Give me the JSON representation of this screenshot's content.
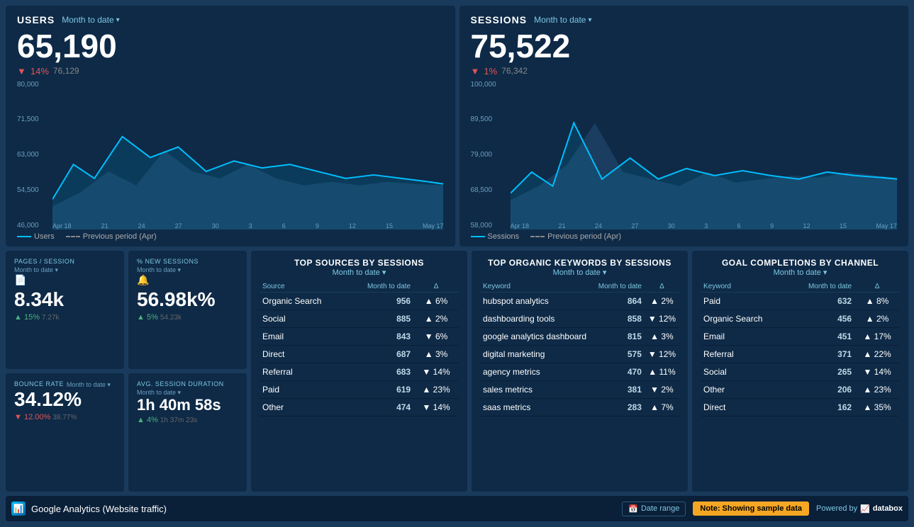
{
  "users": {
    "title": "USERS",
    "period": "Month to date",
    "value": "65,190",
    "change_pct": "14%",
    "change_dir": "down",
    "prev_value": "76,129",
    "legend_current": "Users",
    "legend_prev": "Previous period (Apr)",
    "y_labels": [
      "80,000",
      "71,500",
      "63,000",
      "54,500",
      "46,000"
    ],
    "x_labels": [
      "Apr 18",
      "21",
      "24",
      "27",
      "30",
      "3",
      "6",
      "9",
      "12",
      "15",
      "May 17"
    ]
  },
  "sessions": {
    "title": "SESSIONS",
    "period": "Month to date",
    "value": "75,522",
    "change_pct": "1%",
    "change_dir": "down",
    "prev_value": "76,342",
    "legend_current": "Sessions",
    "legend_prev": "Previous period (Apr)",
    "y_labels": [
      "100,000",
      "89,500",
      "79,000",
      "68,500",
      "58,000"
    ],
    "x_labels": [
      "Apr 18",
      "21",
      "24",
      "27",
      "30",
      "3",
      "6",
      "9",
      "12",
      "15",
      "May 17"
    ]
  },
  "metrics": {
    "pages_per_session": {
      "label": "PAGES / SESSION",
      "period": "Month to date",
      "value": "8.34k",
      "change_pct": "15%",
      "change_dir": "up",
      "prev_value": "7.27k"
    },
    "new_sessions": {
      "label": "% NEW SESSIONS",
      "period": "Month to date",
      "value": "56.98k%",
      "change_pct": "5%",
      "change_dir": "up",
      "prev_value": "54.23k"
    },
    "bounce_rate": {
      "label": "BOUNCE RATE",
      "period": "Month to date",
      "value": "34.12%",
      "change_pct": "12.00%",
      "change_dir": "down",
      "prev_value": "38.77%"
    },
    "avg_session": {
      "label": "AVG. SESSION DURATION",
      "period": "Month to date",
      "value": "1h 40m 58s",
      "change_pct": "4%",
      "change_dir": "up",
      "prev_value": "1h 37m 23s"
    }
  },
  "top_sources": {
    "title": "TOP SOURCES BY SESSIONS",
    "period": "Month to date",
    "columns": [
      "Source",
      "Month to date",
      "Δ"
    ],
    "rows": [
      {
        "name": "Organic Search",
        "value": "956",
        "delta": "6%",
        "dir": "up"
      },
      {
        "name": "Social",
        "value": "885",
        "delta": "2%",
        "dir": "up"
      },
      {
        "name": "Email",
        "value": "843",
        "delta": "6%",
        "dir": "down"
      },
      {
        "name": "Direct",
        "value": "687",
        "delta": "3%",
        "dir": "up"
      },
      {
        "name": "Referral",
        "value": "683",
        "delta": "14%",
        "dir": "down"
      },
      {
        "name": "Paid",
        "value": "619",
        "delta": "23%",
        "dir": "up"
      },
      {
        "name": "Other",
        "value": "474",
        "delta": "14%",
        "dir": "down"
      }
    ]
  },
  "top_keywords": {
    "title": "TOP ORGANIC KEYWORDS BY SESSIONS",
    "period": "Month to date",
    "columns": [
      "Keyword",
      "Month to date",
      "Δ"
    ],
    "rows": [
      {
        "name": "hubspot analytics",
        "value": "864",
        "delta": "2%",
        "dir": "up"
      },
      {
        "name": "dashboarding tools",
        "value": "858",
        "delta": "12%",
        "dir": "down"
      },
      {
        "name": "google analytics dashboard",
        "value": "815",
        "delta": "3%",
        "dir": "up"
      },
      {
        "name": "digital marketing",
        "value": "575",
        "delta": "12%",
        "dir": "down"
      },
      {
        "name": "agency metrics",
        "value": "470",
        "delta": "11%",
        "dir": "up"
      },
      {
        "name": "sales metrics",
        "value": "381",
        "delta": "2%",
        "dir": "down"
      },
      {
        "name": "saas metrics",
        "value": "283",
        "delta": "7%",
        "dir": "up"
      }
    ]
  },
  "goal_completions": {
    "title": "GOAL COMPLETIONS BY CHANNEL",
    "period": "Month to date",
    "columns": [
      "Keyword",
      "Month to date",
      "Δ"
    ],
    "rows": [
      {
        "name": "Paid",
        "value": "632",
        "delta": "8%",
        "dir": "up"
      },
      {
        "name": "Organic Search",
        "value": "456",
        "delta": "2%",
        "dir": "up"
      },
      {
        "name": "Email",
        "value": "451",
        "delta": "17%",
        "dir": "up"
      },
      {
        "name": "Referral",
        "value": "371",
        "delta": "22%",
        "dir": "up"
      },
      {
        "name": "Social",
        "value": "265",
        "delta": "14%",
        "dir": "down"
      },
      {
        "name": "Other",
        "value": "206",
        "delta": "23%",
        "dir": "up"
      },
      {
        "name": "Direct",
        "value": "162",
        "delta": "35%",
        "dir": "up"
      }
    ]
  },
  "footer": {
    "app_name": "Google Analytics (Website traffic)",
    "date_range": "Date range",
    "sample_note": "Note: Showing sample data",
    "powered_by": "Powered by",
    "brand": "databox"
  }
}
